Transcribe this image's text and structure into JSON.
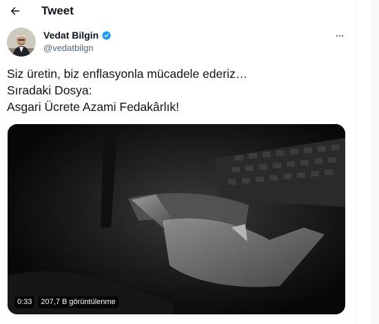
{
  "header": {
    "title": "Tweet",
    "back_icon": "arrow-left-icon"
  },
  "author": {
    "display_name": "Vedat Bilgin",
    "handle": "@vedatbilgn",
    "verified_icon": "verified-badge-icon",
    "verified_color": "#1d9bf0"
  },
  "tweet": {
    "lines": [
      "Siz üretin, biz enflasyonla mücadele ederiz…",
      "Sıradaki Dosya:",
      "Asgari Ücrete Azami Fedakârlık!"
    ],
    "more_icon": "more-horizontal-icon"
  },
  "video": {
    "duration": "0:33",
    "views": "207,7 B görüntülenme"
  },
  "colors": {
    "text": "#0f1419",
    "secondary_text": "#536471",
    "accent": "#1d9bf0",
    "border": "#eff3f4"
  }
}
